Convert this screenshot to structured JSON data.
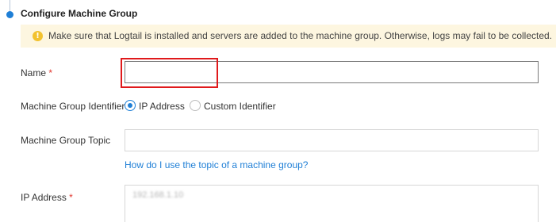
{
  "section": {
    "title": "Configure Machine Group"
  },
  "notice": {
    "icon": "warning-icon",
    "icon_glyph": "!",
    "text": "Make sure that Logtail is installed and servers are added to the machine group. Otherwise, logs may fail to be collected."
  },
  "form": {
    "name": {
      "label": "Name",
      "required_mark": "*",
      "value": "",
      "placeholder": ""
    },
    "identifier": {
      "label": "Machine Group Identifier",
      "options": [
        "IP Address",
        "Custom Identifier"
      ],
      "selected": "IP Address"
    },
    "topic": {
      "label": "Machine Group Topic",
      "value": "",
      "placeholder": "",
      "help_link": "How do I use the topic of a machine group?"
    },
    "ip_address": {
      "label": "IP Address",
      "required_mark": "*",
      "value": "192.168.1.10"
    }
  },
  "colors": {
    "accent": "#1f7fd6",
    "required": "#e0342c",
    "notice_bg": "#fdf6e0",
    "warning_icon": "#f2c230",
    "highlight": "#e0191b"
  }
}
